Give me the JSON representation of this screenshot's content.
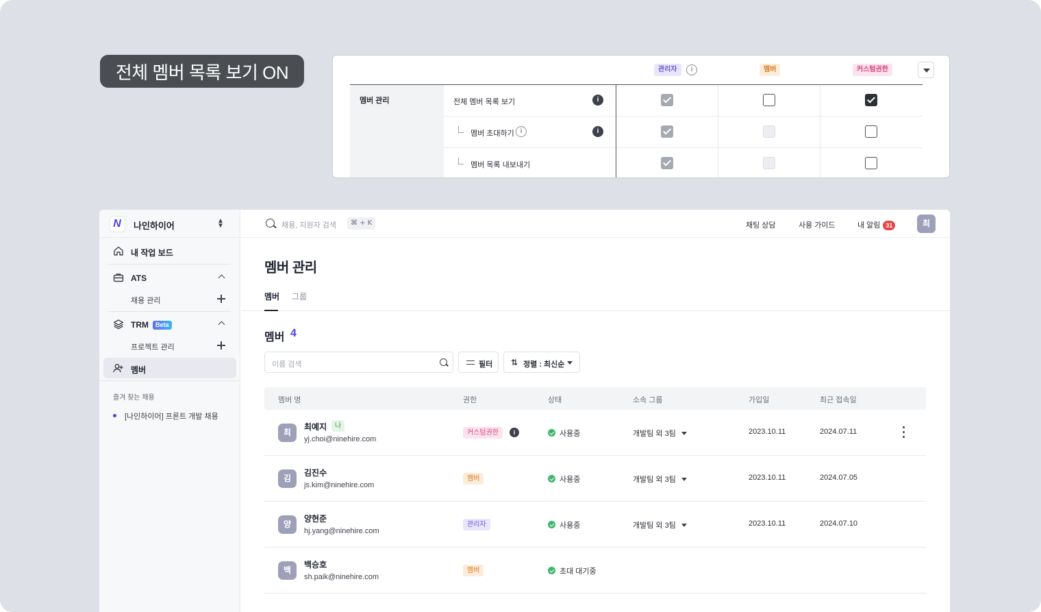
{
  "label_pill": {
    "text": "전체 멤버 목록 보기 ON"
  },
  "permission_table": {
    "roles": [
      {
        "label": "관리자",
        "color": "#6b5bd6",
        "bg": "#e9e6fb"
      },
      {
        "label": "멤버",
        "color": "#d97a1d",
        "bg": "#fdecd9"
      },
      {
        "label": "커스텀권한",
        "color": "#d2457e",
        "bg": "#fde3ee"
      }
    ],
    "section": "멤버 관리",
    "rows": [
      {
        "label": "전체 멤버 목록 보기",
        "states": [
          "checked-locked",
          "unchecked",
          "checked"
        ]
      },
      {
        "label": "멤버 초대하기",
        "states": [
          "checked-locked",
          "disabled",
          "unchecked"
        ]
      },
      {
        "label": "멤버 목록 내보내기",
        "states": [
          "checked-locked",
          "disabled",
          "unchecked"
        ]
      }
    ]
  },
  "sidebar": {
    "org_name": "나인하이어",
    "items": [
      {
        "label": "내 작업 보드",
        "icon": "home-icon"
      },
      {
        "label": "ATS",
        "icon": "briefcase-icon"
      },
      {
        "label": "채용 관리"
      },
      {
        "label": "TRM",
        "icon": "layers-icon",
        "badge": "Beta"
      },
      {
        "label": "프로젝트 관리"
      },
      {
        "label": "멤버",
        "icon": "user-add-icon",
        "active": true
      }
    ],
    "favorites_title": "즐겨 찾는 채용",
    "favorites": [
      "[나인하이어] 프론트 개발 채용"
    ]
  },
  "topbar": {
    "search_placeholder": "채용, 지원자 검색",
    "shortcut": "⌘ + K",
    "chat": "채팅 상담",
    "guide": "사용 가이드",
    "notifications": "내 알림",
    "notification_count": "31",
    "avatar": "최"
  },
  "main": {
    "title": "멤버 관리",
    "tabs": [
      "멤버",
      "그룹"
    ],
    "section_title": "멤버",
    "member_count": "4",
    "name_search_placeholder": "이름 검색",
    "filter_label": "필터",
    "sort_label": "정렬 : 최신순",
    "columns": [
      "멤버 명",
      "권한",
      "상태",
      "소속 그룹",
      "가입일",
      "최근 접속일"
    ],
    "members": [
      {
        "avatar": "최",
        "name": "최예지",
        "me": "나",
        "email": "yj.choi@ninehire.com",
        "role": "커스텀권한",
        "status": "사용중",
        "group": "개발팀 외 3팀",
        "joined": "2023.10.11",
        "last": "2024.07.11"
      },
      {
        "avatar": "김",
        "name": "김진수",
        "email": "js.kim@ninehire.com",
        "role": "멤버",
        "status": "사용중",
        "group": "개발팀 외 3팀",
        "joined": "2023.10.11",
        "last": "2024.07.05"
      },
      {
        "avatar": "양",
        "name": "양현준",
        "email": "hj.yang@ninehire.com",
        "role": "관리자",
        "status": "사용중",
        "group": "개발팀 외 3팀",
        "joined": "2023.10.11",
        "last": "2024.07.10"
      },
      {
        "avatar": "백",
        "name": "백승호",
        "email": "sh.paik@ninehire.com",
        "role": "멤버",
        "status": "초대 대기중"
      }
    ]
  }
}
